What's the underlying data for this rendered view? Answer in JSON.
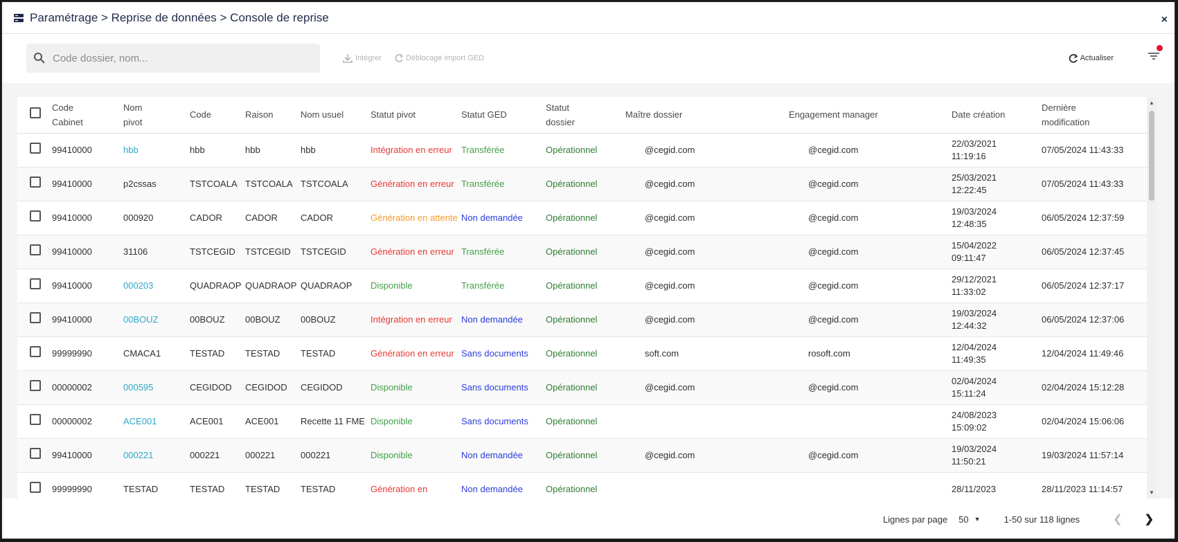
{
  "titlebar": {
    "breadcrumb": "Paramétrage > Reprise de données > Console de reprise",
    "close": "×"
  },
  "toolbar": {
    "search_placeholder": "Code dossier, nom...",
    "integrer": "Intégrer",
    "deblocage": "Déblocage import GED",
    "actualiser": "Actualiser"
  },
  "table": {
    "headers": {
      "code_cabinet_1": "Code",
      "code_cabinet_2": "Cabinet",
      "nom_pivot_1": "Nom",
      "nom_pivot_2": "pivot",
      "code": "Code",
      "raison": "Raison",
      "nom_usuel": "Nom usuel",
      "statut_pivot": "Statut pivot",
      "statut_ged": "Statut GED",
      "statut_dossier_1": "Statut",
      "statut_dossier_2": "dossier",
      "maitre_dossier": "Maître dossier",
      "engagement_manager": "Engagement manager",
      "date_creation": "Date création",
      "derniere_modif_1": "Dernière",
      "derniere_modif_2": "modification"
    },
    "rows": [
      {
        "cabinet": "99410000",
        "nom": "hbb",
        "nom_link": true,
        "code": "hbb",
        "raison": "hbb",
        "usuel": "hbb",
        "pivot": "Intégration en erreur",
        "pivot_color": "red",
        "ged": "Transférée",
        "ged_color": "green",
        "dossier": "Opérationnel",
        "maitre": "@cegid.com",
        "engagement": "@cegid.com",
        "creation_1": "22/03/2021",
        "creation_2": "11:19:16",
        "modif": "07/05/2024 11:43:33"
      },
      {
        "cabinet": "99410000",
        "nom": "p2cssas",
        "nom_link": false,
        "code": "TSTCOALA",
        "raison": "TSTCOALA",
        "usuel": "TSTCOALA",
        "pivot": "Génération en erreur",
        "pivot_color": "red",
        "ged": "Transférée",
        "ged_color": "green",
        "dossier": "Opérationnel",
        "maitre": "@cegid.com",
        "engagement": "@cegid.com",
        "creation_1": "25/03/2021",
        "creation_2": "12:22:45",
        "modif": "07/05/2024 11:43:33"
      },
      {
        "cabinet": "99410000",
        "nom": "000920",
        "nom_link": false,
        "code": "CADOR",
        "raison": "CADOR",
        "usuel": "CADOR",
        "pivot": "Génération en attente",
        "pivot_color": "orange",
        "ged": "Non demandée",
        "ged_color": "blue",
        "dossier": "Opérationnel",
        "maitre": "@cegid.com",
        "engagement": "@cegid.com",
        "creation_1": "19/03/2024",
        "creation_2": "12:48:35",
        "modif": "06/05/2024 12:37:59"
      },
      {
        "cabinet": "99410000",
        "nom": "31106",
        "nom_link": false,
        "code": "TSTCEGID",
        "raison": "TSTCEGID",
        "usuel": "TSTCEGID",
        "pivot": "Génération en erreur",
        "pivot_color": "red",
        "ged": "Transférée",
        "ged_color": "green",
        "dossier": "Opérationnel",
        "maitre": "@cegid.com",
        "engagement": "@cegid.com",
        "creation_1": "15/04/2022",
        "creation_2": "09:11:47",
        "modif": "06/05/2024 12:37:45"
      },
      {
        "cabinet": "99410000",
        "nom": "000203",
        "nom_link": true,
        "code": "QUADRAOP",
        "raison": "QUADRAOP",
        "usuel": "QUADRAOP",
        "pivot": "Disponible",
        "pivot_color": "green",
        "ged": "Transférée",
        "ged_color": "green",
        "dossier": "Opérationnel",
        "maitre": "@cegid.com",
        "engagement": "@cegid.com",
        "creation_1": "29/12/2021",
        "creation_2": "11:33:02",
        "modif": "06/05/2024 12:37:17"
      },
      {
        "cabinet": "99410000",
        "nom": "00BOUZ",
        "nom_link": true,
        "code": "00BOUZ",
        "raison": "00BOUZ",
        "usuel": "00BOUZ",
        "pivot": "Intégration en erreur",
        "pivot_color": "red",
        "ged": "Non demandée",
        "ged_color": "blue",
        "dossier": "Opérationnel",
        "maitre": "@cegid.com",
        "engagement": "@cegid.com",
        "creation_1": "19/03/2024",
        "creation_2": "12:44:32",
        "modif": "06/05/2024 12:37:06"
      },
      {
        "cabinet": "99999990",
        "nom": "CMACA1",
        "nom_link": false,
        "code": "TESTAD",
        "raison": "TESTAD",
        "usuel": "TESTAD",
        "pivot": "Génération en erreur",
        "pivot_color": "red",
        "ged": "Sans documents",
        "ged_color": "blue",
        "dossier": "Opérationnel",
        "maitre": "soft.com",
        "engagement": "rosoft.com",
        "creation_1": "12/04/2024",
        "creation_2": "11:49:35",
        "modif": "12/04/2024 11:49:46"
      },
      {
        "cabinet": "00000002",
        "nom": "000595",
        "nom_link": true,
        "code": "CEGIDOD",
        "raison": "CEGIDOD",
        "usuel": "CEGIDOD",
        "pivot": "Disponible",
        "pivot_color": "green",
        "ged": "Sans documents",
        "ged_color": "blue",
        "dossier": "Opérationnel",
        "maitre": "@cegid.com",
        "engagement": "@cegid.com",
        "creation_1": "02/04/2024",
        "creation_2": "15:11:24",
        "modif": "02/04/2024 15:12:28"
      },
      {
        "cabinet": "00000002",
        "nom": "ACE001",
        "nom_link": true,
        "code": "ACE001",
        "raison": "ACE001",
        "usuel": "Recette 11 FME",
        "pivot": "Disponible",
        "pivot_color": "green",
        "ged": "Sans documents",
        "ged_color": "blue",
        "dossier": "Opérationnel",
        "maitre": "",
        "engagement": "",
        "creation_1": "24/08/2023",
        "creation_2": "15:09:02",
        "modif": "02/04/2024 15:06:06"
      },
      {
        "cabinet": "99410000",
        "nom": "000221",
        "nom_link": true,
        "code": "000221",
        "raison": "000221",
        "usuel": "000221",
        "pivot": "Disponible",
        "pivot_color": "green",
        "ged": "Non demandée",
        "ged_color": "blue",
        "dossier": "Opérationnel",
        "maitre": "@cegid.com",
        "engagement": "@cegid.com",
        "creation_1": "19/03/2024",
        "creation_2": "11:50:21",
        "modif": "19/03/2024 11:57:14"
      },
      {
        "cabinet": "99999990",
        "nom": "TESTAD",
        "nom_link": false,
        "code": "TESTAD",
        "raison": "TESTAD",
        "usuel": "TESTAD",
        "pivot": "Génération en",
        "pivot_color": "red",
        "ged": "Non demandée",
        "ged_color": "blue",
        "dossier": "Opérationnel",
        "maitre": "",
        "engagement": "",
        "creation_1": "28/11/2023",
        "creation_2": "",
        "modif": "28/11/2023 11:14:57"
      }
    ]
  },
  "footer": {
    "rows_per_page_label": "Lignes par page",
    "rows_per_page_value": "50",
    "range": "1-50 sur 118 lignes"
  },
  "colors": {
    "red": "#e53935",
    "orange": "#f49b2e",
    "green": "#43a047",
    "blue": "#2b3ddb",
    "link": "#2fa7c9"
  }
}
